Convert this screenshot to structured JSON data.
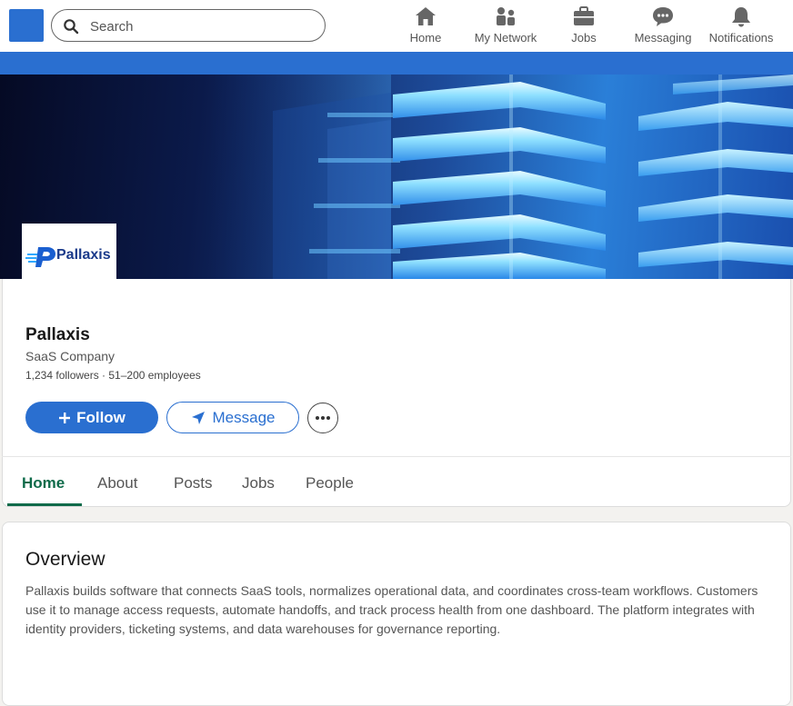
{
  "search": {
    "placeholder": "Search"
  },
  "nav": [
    {
      "label": "Home",
      "icon": "home-icon"
    },
    {
      "label": "My Network",
      "icon": "network-icon"
    },
    {
      "label": "Jobs",
      "icon": "briefcase-icon"
    },
    {
      "label": "Messaging",
      "icon": "messaging-icon"
    },
    {
      "label": "Notifications",
      "icon": "bell-icon"
    }
  ],
  "company": {
    "logo_text": "Pallaxis",
    "name": "Pallaxis",
    "type": "SaaS Company",
    "meta": "1,234 followers · 51–200 employees"
  },
  "actions": {
    "follow_label": "Follow",
    "message_label": "Message"
  },
  "tabs": [
    {
      "label": "Home",
      "active": true
    },
    {
      "label": "About"
    },
    {
      "label": "Posts"
    },
    {
      "label": "Jobs"
    },
    {
      "label": "People"
    }
  ],
  "overview": {
    "title": "Overview",
    "body": "Pallaxis builds software that connects SaaS tools, normalizes operational data, and coordinates cross-team workflows. Customers use it to manage access requests, automate handoffs, and track process health from one dashboard. The platform integrates with identity providers, ticketing systems, and data warehouses for governance reporting."
  },
  "colors": {
    "brand_blue": "#2a6fd0",
    "active_tab": "#0f6b4a"
  }
}
